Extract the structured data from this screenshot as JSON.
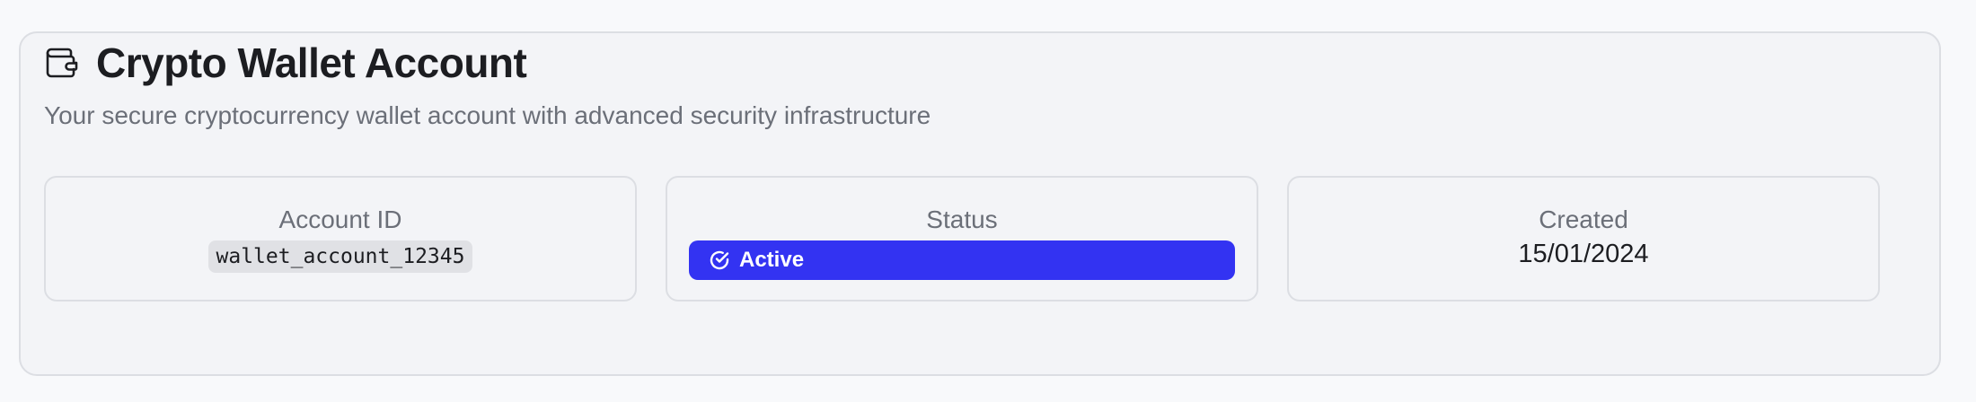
{
  "header": {
    "icon": "wallet-icon",
    "title": "Crypto Wallet Account",
    "subtitle": "Your secure cryptocurrency wallet account with advanced security infrastructure"
  },
  "stats": {
    "account": {
      "label": "Account ID",
      "value": "wallet_account_12345"
    },
    "status": {
      "label": "Status",
      "value": "Active",
      "icon": "check-circle-icon",
      "color": "#3333f2"
    },
    "created": {
      "label": "Created",
      "value": "15/01/2024"
    }
  },
  "colors": {
    "background": "#f8f9fb",
    "card": "#f3f4f7",
    "border": "#dcdee3",
    "text": "#1c1d21",
    "muted": "#6b6f78",
    "accent": "#3333f2"
  }
}
